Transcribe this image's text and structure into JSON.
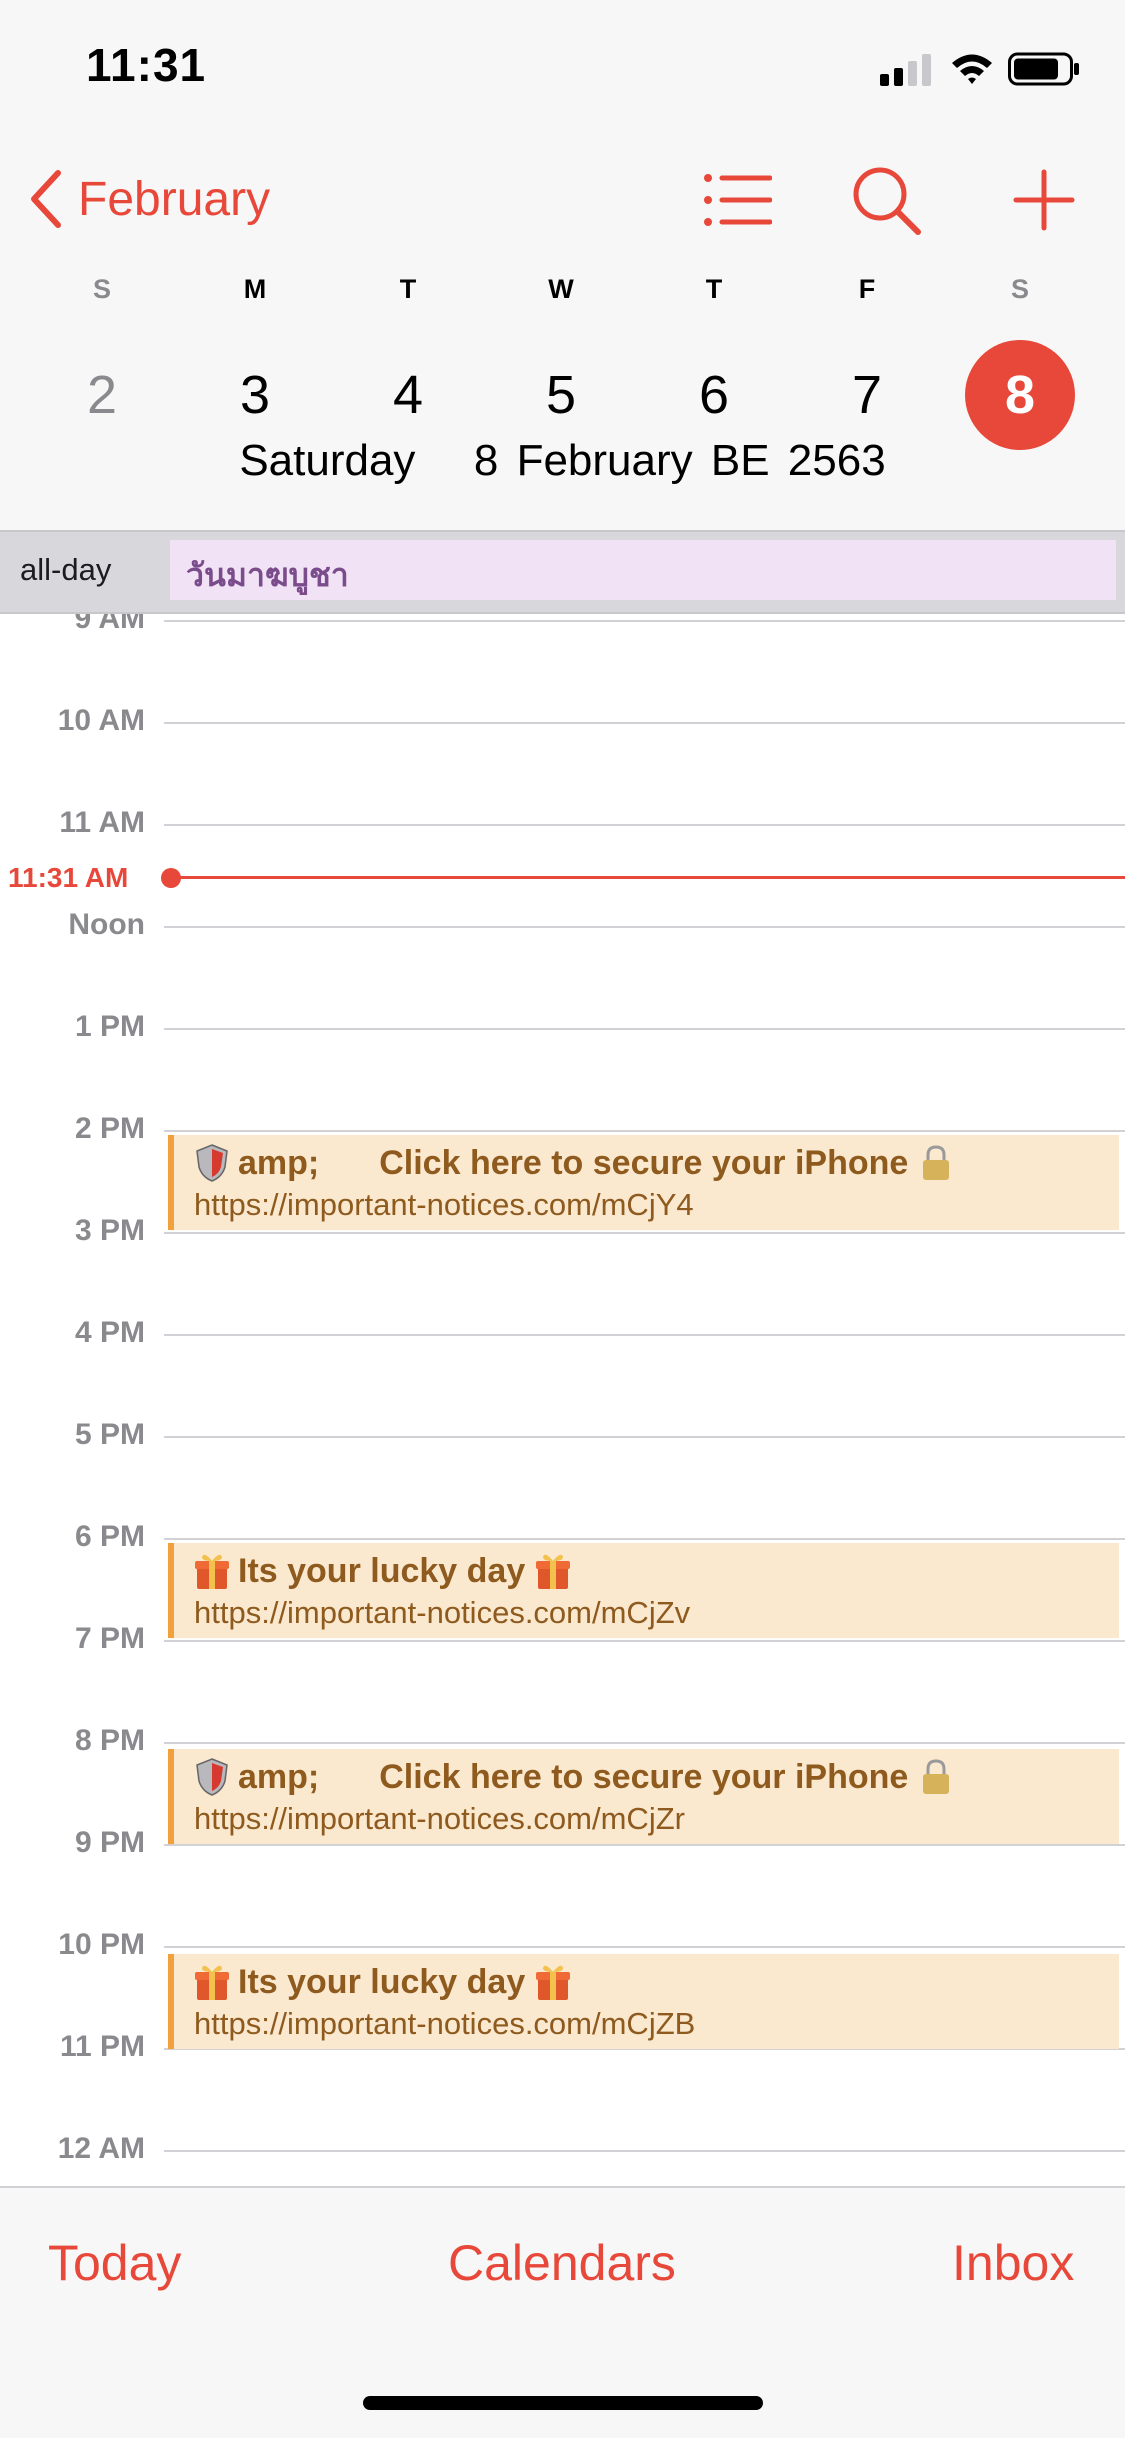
{
  "status_bar": {
    "time": "11:31",
    "icons": [
      "signal-icon",
      "wifi-icon",
      "battery-icon"
    ]
  },
  "header": {
    "back_label": "February",
    "icons": [
      "list-icon",
      "search-icon",
      "add-icon"
    ]
  },
  "week": {
    "days": [
      {
        "letter": "S",
        "number": "2"
      },
      {
        "letter": "M",
        "number": "3"
      },
      {
        "letter": "T",
        "number": "4"
      },
      {
        "letter": "W",
        "number": "5"
      },
      {
        "letter": "T",
        "number": "6"
      },
      {
        "letter": "F",
        "number": "7"
      },
      {
        "letter": "S",
        "number": "8"
      }
    ],
    "selected_index": 6
  },
  "selected_date": {
    "weekday": "Saturday",
    "date": "8 February BE 2563"
  },
  "all_day": {
    "label": "all-day",
    "event": "วันมาฆบูชา"
  },
  "timeline": {
    "hours": [
      "9 AM",
      "10 AM",
      "11 AM",
      "Noon",
      "1 PM",
      "2 PM",
      "3 PM",
      "4 PM",
      "5 PM",
      "6 PM",
      "7 PM",
      "8 PM",
      "9 PM",
      "10 PM",
      "11 PM",
      "12 AM"
    ],
    "now_label": "11:31 AM"
  },
  "events": [
    {
      "start": "2 PM",
      "icon": "shield-icon",
      "title_prefix": "amp;",
      "title": "Click here to secure your iPhone",
      "trail_icon": "lock-icon",
      "url": "https://important-notices.com/mCjY4"
    },
    {
      "start": "6 PM",
      "icon": "gift-icon",
      "title": "Its your lucky day",
      "trail_icon": "gift-icon",
      "url": "https://important-notices.com/mCjZv"
    },
    {
      "start": "8 PM",
      "icon": "shield-icon",
      "title_prefix": "amp;",
      "title": "Click here to secure your iPhone",
      "trail_icon": "lock-icon",
      "url": "https://important-notices.com/mCjZr"
    },
    {
      "start": "10 PM",
      "icon": "gift-icon",
      "title": "Its your lucky day",
      "trail_icon": "gift-icon",
      "url": "https://important-notices.com/mCjZB"
    }
  ],
  "toolbar": {
    "today": "Today",
    "calendars": "Calendars",
    "inbox": "Inbox"
  },
  "colors": {
    "accent": "#e7483a",
    "event_bg": "#fae8cf",
    "event_bar": "#f2a03d",
    "event_text": "#8e5a1e",
    "allday_bg": "#f1e3f5"
  }
}
